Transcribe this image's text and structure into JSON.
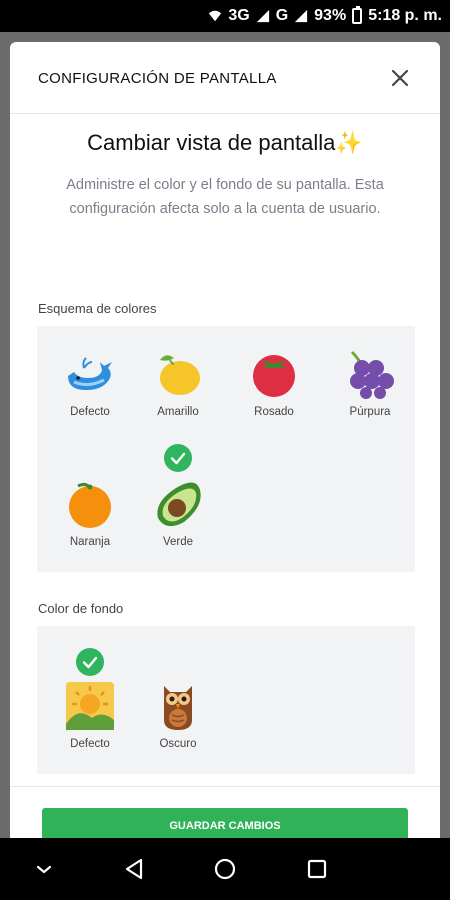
{
  "status_bar": {
    "network_1": "3G",
    "network_2": "G",
    "battery": "93%",
    "time": "5:18 p. m."
  },
  "dialog": {
    "title": "CONFIGURACIÓN DE PANTALLA",
    "heading": "Cambiar vista de pantalla",
    "heading_emoji": "✨",
    "subtitle": "Administre el color y el fondo de su pantalla. Esta configuración afecta solo a la cuenta de usuario."
  },
  "color_scheme": {
    "label": "Esquema de colores",
    "options": [
      {
        "label": "Defecto",
        "icon": "whale-icon",
        "selected": false
      },
      {
        "label": "Amarillo",
        "icon": "lemon-icon",
        "selected": false
      },
      {
        "label": "Rosado",
        "icon": "tomato-icon",
        "selected": false
      },
      {
        "label": "Púrpura",
        "icon": "grapes-icon",
        "selected": false
      },
      {
        "label": "Naranja",
        "icon": "orange-icon",
        "selected": false
      },
      {
        "label": "Verde",
        "icon": "avocado-icon",
        "selected": true
      }
    ]
  },
  "background_color": {
    "label": "Color de fondo",
    "options": [
      {
        "label": "Defecto",
        "icon": "sunrise-landscape-icon",
        "selected": true
      },
      {
        "label": "Oscuro",
        "icon": "owl-icon",
        "selected": false
      }
    ]
  },
  "save_button": {
    "label": "GUARDAR CAMBIOS"
  },
  "colors": {
    "accent": "#30b358",
    "panel": "#f2f3f5"
  }
}
